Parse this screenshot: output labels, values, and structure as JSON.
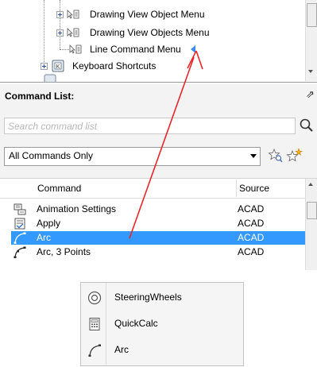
{
  "tree": {
    "items": [
      {
        "label": "Drawing View Object Menu"
      },
      {
        "label": "Drawing View Objects Menu"
      },
      {
        "label": "Line Command Menu"
      },
      {
        "label": "Keyboard Shortcuts"
      }
    ]
  },
  "command_list": {
    "title": "Command List:",
    "search_placeholder": "Search command list",
    "filter_value": "All Commands Only",
    "columns": {
      "command": "Command",
      "source": "Source"
    },
    "rows": [
      {
        "name": "Animation Settings",
        "source": "ACAD",
        "icon": "animation-settings-icon",
        "selected": false
      },
      {
        "name": "Apply",
        "source": "ACAD",
        "icon": "apply-icon",
        "selected": false
      },
      {
        "name": "Arc",
        "source": "ACAD",
        "icon": "arc-icon",
        "selected": true
      },
      {
        "name": "Arc, 3 Points",
        "source": "ACAD",
        "icon": "arc-3-points-icon",
        "selected": false
      }
    ]
  },
  "context_menu": {
    "items": [
      {
        "label": "SteeringWheels",
        "icon": "steering-wheels-icon"
      },
      {
        "label": "QuickCalc",
        "icon": "calculator-icon"
      },
      {
        "label": "Arc",
        "icon": "arc-icon"
      }
    ]
  },
  "colors": {
    "selection": "#3399ff",
    "annotation_arrow": "#e8262a",
    "marker": "#3a8ee6"
  }
}
